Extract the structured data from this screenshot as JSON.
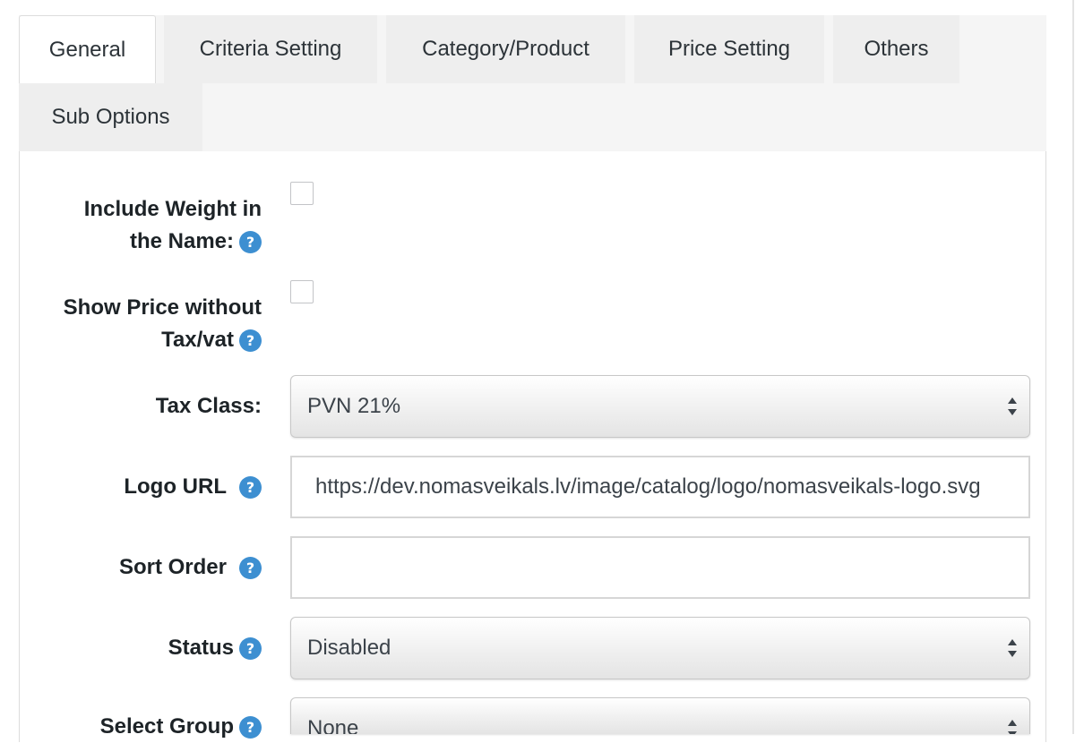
{
  "tabs": [
    {
      "label": "General",
      "active": true
    },
    {
      "label": "Criteria Setting",
      "active": false
    },
    {
      "label": "Category/Product",
      "active": false
    },
    {
      "label": "Price Setting",
      "active": false
    },
    {
      "label": "Others",
      "active": false
    },
    {
      "label": "Sub Options",
      "active": false
    }
  ],
  "form": {
    "include_weight": {
      "label_line1": "Include Weight in",
      "label_line2": "the Name:",
      "checked": false
    },
    "show_price_without_tax": {
      "label_line1": "Show Price without",
      "label_line2": "Tax/vat",
      "checked": false
    },
    "tax_class": {
      "label": "Tax Class:",
      "value": "PVN 21%"
    },
    "logo_url": {
      "label": "Logo URL",
      "value": "https://dev.nomasveikals.lv/image/catalog/logo/nomasveikals-logo.svg"
    },
    "sort_order": {
      "label": "Sort Order",
      "value": ""
    },
    "status": {
      "label": "Status",
      "value": "Disabled"
    },
    "select_group": {
      "label": "Select Group",
      "value": "None"
    }
  },
  "help_glyph": "?",
  "colors": {
    "help_icon": "#3d8fd1",
    "tab_bar": "#f5f5f5",
    "text": "#1d2327"
  }
}
